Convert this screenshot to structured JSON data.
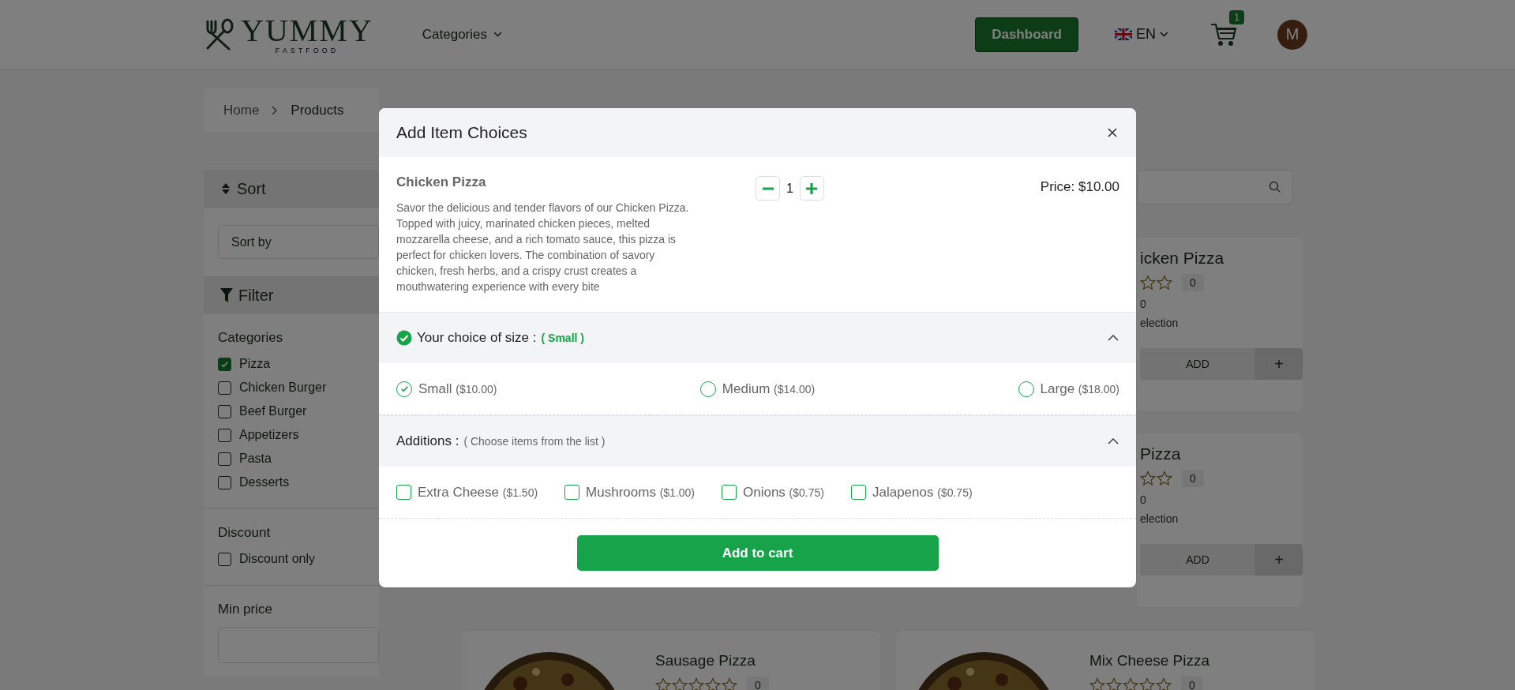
{
  "header": {
    "logo": {
      "name": "YUMMY",
      "tagline": "FASTFOOD"
    },
    "nav": [
      {
        "label": "Categories"
      }
    ],
    "dashboard": "Dashboard",
    "language": "EN",
    "cart_count": "1",
    "avatar": "M"
  },
  "breadcrumb": [
    "Home",
    "Products"
  ],
  "sidebar": {
    "sort": {
      "title": "Sort",
      "select_value": "Sort by"
    },
    "filter": {
      "title": "Filter"
    },
    "groups": [
      {
        "title": "Categories",
        "items": [
          {
            "label": "Pizza",
            "checked": true
          },
          {
            "label": "Chicken Burger",
            "checked": false
          },
          {
            "label": "Beef Burger",
            "checked": false
          },
          {
            "label": "Appetizers",
            "checked": false
          },
          {
            "label": "Pasta",
            "checked": false
          },
          {
            "label": "Desserts",
            "checked": false
          }
        ]
      },
      {
        "title": "Discount",
        "items": [
          {
            "label": "Discount only",
            "checked": false
          }
        ]
      }
    ],
    "min_price": {
      "title": "Min price"
    }
  },
  "partial_cards": [
    {
      "name": "icken Pizza",
      "rating_count": "0",
      "price": "0",
      "note": "election",
      "add": "ADD",
      "plus": "+"
    },
    {
      "name": "Pizza",
      "rating_count": "0",
      "price": "0",
      "note": "election",
      "add": "ADD",
      "plus": "+"
    }
  ],
  "products": [
    {
      "name": "Sausage Pizza",
      "stars": 0,
      "rating_count": "0"
    },
    {
      "name": "Mix Cheese Pizza",
      "stars": 0,
      "rating_count": "0"
    }
  ],
  "modal": {
    "title": "Add Item Choices",
    "product": {
      "name": "Chicken Pizza",
      "description": "Savor the delicious and tender flavors of our Chicken Pizza. Topped with juicy, marinated chicken pieces, melted mozzarella cheese, and a rich tomato sauce, this pizza is perfect for chicken lovers. The combination of savory chicken, fresh herbs, and a crispy crust creates a mouthwatering experience with every bite",
      "quantity": "1",
      "price": "Price: $10.00"
    },
    "sections": [
      {
        "kind": "radio",
        "title": "Your choice of size :",
        "hint": "( Small )",
        "complete": true,
        "expanded": true,
        "options": [
          {
            "label": "Small",
            "price": "($10.00)",
            "selected": true
          },
          {
            "label": "Medium",
            "price": "($14.00)",
            "selected": false
          },
          {
            "label": "Large",
            "price": "($18.00)",
            "selected": false
          }
        ]
      },
      {
        "kind": "checkbox",
        "title": "Additions :",
        "hint": "( Choose items from the list )",
        "complete": false,
        "expanded": true,
        "options": [
          {
            "label": "Extra Cheese",
            "price": "($1.50)",
            "checked": false
          },
          {
            "label": "Mushrooms",
            "price": "($1.00)",
            "checked": false
          },
          {
            "label": "Onions",
            "price": "($0.75)",
            "checked": false
          },
          {
            "label": "Jalapenos",
            "price": "($0.75)",
            "checked": false
          }
        ]
      }
    ],
    "submit": "Add to cart"
  }
}
